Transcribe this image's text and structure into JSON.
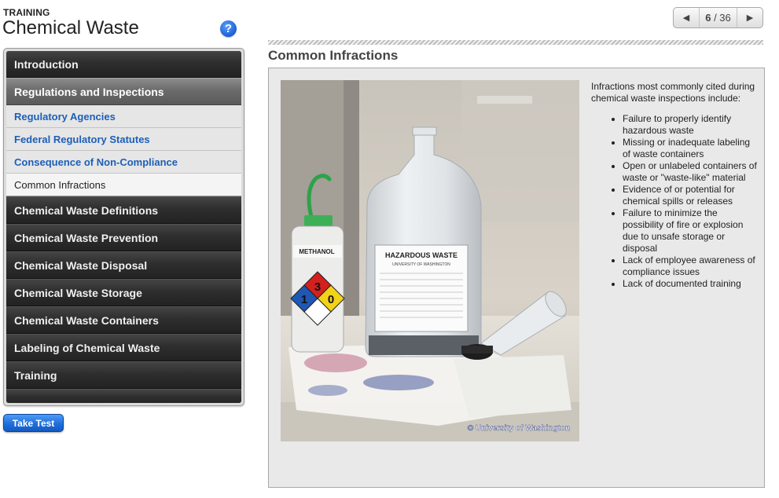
{
  "header": {
    "eyebrow": "TRAINING",
    "title": "Chemical Waste",
    "help_glyph": "?"
  },
  "pager": {
    "prev_glyph": "◀",
    "next_glyph": "▶",
    "current": "6",
    "separator": " / ",
    "total": "36"
  },
  "sidebar": {
    "items": [
      {
        "label": "Introduction"
      },
      {
        "label": "Regulations and Inspections"
      },
      {
        "label": "Regulatory Agencies"
      },
      {
        "label": "Federal Regulatory Statutes"
      },
      {
        "label": "Consequence of Non-Compliance"
      },
      {
        "label": "Common Infractions"
      },
      {
        "label": "Chemical Waste Definitions"
      },
      {
        "label": "Chemical Waste Prevention"
      },
      {
        "label": "Chemical Waste Disposal"
      },
      {
        "label": "Chemical Waste Storage"
      },
      {
        "label": "Chemical Waste Containers"
      },
      {
        "label": "Labeling of Chemical Waste"
      },
      {
        "label": "Training"
      }
    ]
  },
  "take_test_label": "Take Test",
  "content": {
    "section_title": "Common Infractions",
    "intro": "Infractions most commonly cited during chemical waste inspections include:",
    "bullets": [
      "Failure to properly identify hazardous waste",
      "Missing or inadequate labeling of waste containers",
      "Open or unlabeled containers of waste or \"waste-like\" material",
      "Evidence of or potential for chemical spills or releases",
      "Failure to minimize the possibility of fire or explosion due to unsafe storage or disposal",
      "Lack of employee awareness of compliance issues",
      "Lack of documented training"
    ]
  },
  "photo": {
    "jug_label": "HAZARDOUS WASTE",
    "jug_sublabel": "UNIVERSITY OF WASHINGTON",
    "bottle_label": "METHANOL",
    "nfpa_top": "3",
    "nfpa_left": "1",
    "nfpa_right": "0",
    "credit": "© University of Washington"
  },
  "colors": {
    "accent_blue": "#1d5fb8",
    "button_blue": "#1f6fdc",
    "nav_dark": "#2e2e2e",
    "nav_active": "#6b6b6b"
  }
}
